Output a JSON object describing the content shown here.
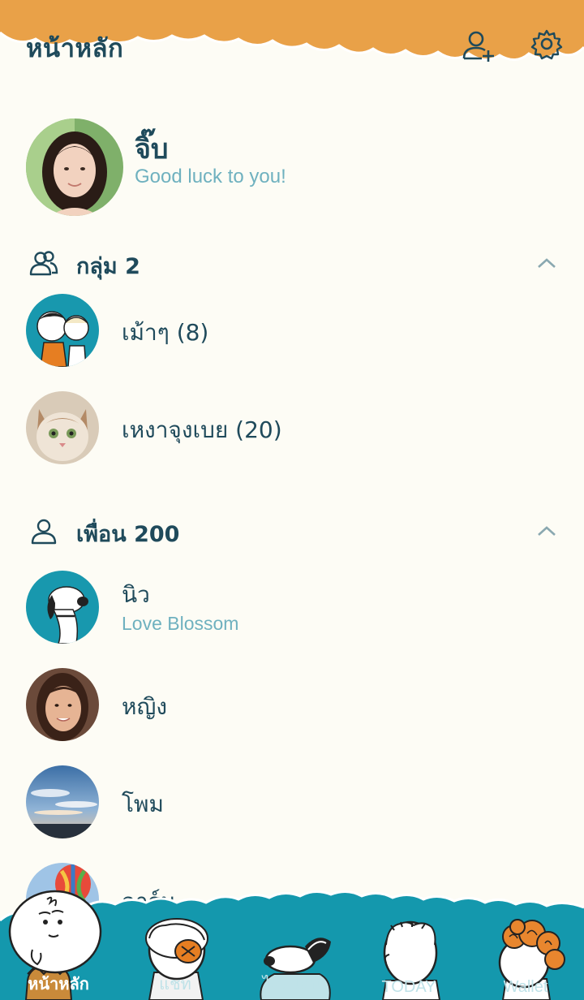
{
  "colors": {
    "header_orange": "#e9a148",
    "footer_teal": "#1498ad",
    "text_dark": "#1f4a5b",
    "text_status": "#6fb1bf",
    "background": "#fdfcf5"
  },
  "header": {
    "title": "หน้าหลัก",
    "add_friend_icon": "add-friend-icon",
    "settings_icon": "gear-icon"
  },
  "profile": {
    "name": "จิ๊บ",
    "status": "Good luck to you!"
  },
  "groups": {
    "label": "กลุ่ม 2",
    "items": [
      {
        "name": "เม้าๆ (8)"
      },
      {
        "name": "เหงาจุงเบย (20)"
      }
    ]
  },
  "friends": {
    "label": "เพื่อน 200",
    "items": [
      {
        "name": "นิว",
        "status": "Love Blossom"
      },
      {
        "name": "หญิง"
      },
      {
        "name": "โพม"
      },
      {
        "name": "อาร์ม."
      }
    ]
  },
  "tabs": [
    {
      "label": "หน้าหลัก",
      "active": true
    },
    {
      "label": "แชท"
    },
    {
      "label": "ไทม์ไลน์"
    },
    {
      "label": "TODAY"
    },
    {
      "label": "Wallet"
    }
  ]
}
